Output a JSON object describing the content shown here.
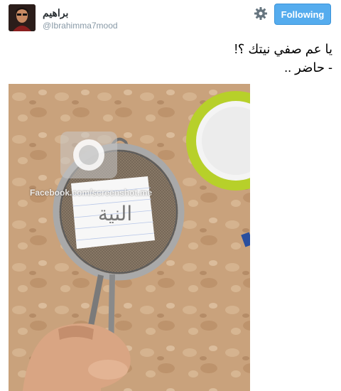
{
  "user": {
    "display_name": "براهيم",
    "screen_name": "@Ibrahimma7mood"
  },
  "actions": {
    "follow_label": "Following",
    "follow_color": "#55acee"
  },
  "icons": {
    "settings": "gear-icon",
    "watermark": "camera-logo-icon"
  },
  "tweet": {
    "line1": "يا عم صفي نيتك ؟!",
    "line2": "- حاضر .."
  },
  "photo": {
    "watermark_text": "Facebook.com/screenshot.me",
    "paper_text": "النية"
  }
}
